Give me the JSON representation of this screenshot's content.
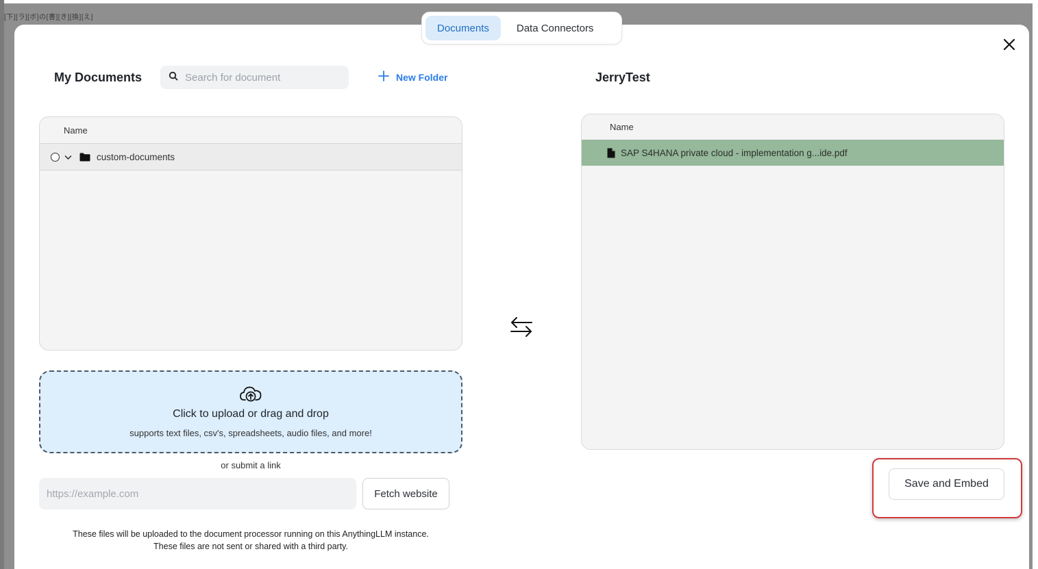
{
  "backdrop": {
    "text": "[下][ラ][ボ]の[書][き][換][え]"
  },
  "tabs": [
    {
      "label": "Documents",
      "active": true
    },
    {
      "label": "Data Connectors",
      "active": false
    }
  ],
  "left": {
    "title": "My Documents",
    "search_placeholder": "Search for document",
    "new_folder_label": "New Folder",
    "column_name": "Name",
    "folder": {
      "name": "custom-documents",
      "icon": "folder-icon"
    }
  },
  "right": {
    "title": "JerryTest",
    "column_name": "Name",
    "files": [
      {
        "name": "SAP S4HANA private cloud - implementation g...ide.pdf",
        "icon": "file-icon"
      }
    ]
  },
  "upload": {
    "title": "Click to upload or drag and drop",
    "subtitle": "supports text files, csv's, spreadsheets, audio files, and more!",
    "or_link": "or submit a link",
    "url_placeholder": "https://example.com",
    "fetch_label": "Fetch website",
    "footnote_line1": "These files will be uploaded to the document processor running on this AnythingLLM instance.",
    "footnote_line2": "These files are not sent or shared with a third party."
  },
  "actions": {
    "save_label": "Save and Embed"
  },
  "colors": {
    "accent": "#2b7de9",
    "tab_active_bg": "#dcebfa",
    "selected_row": "#96b89b",
    "highlight_border": "#d13a3a"
  }
}
